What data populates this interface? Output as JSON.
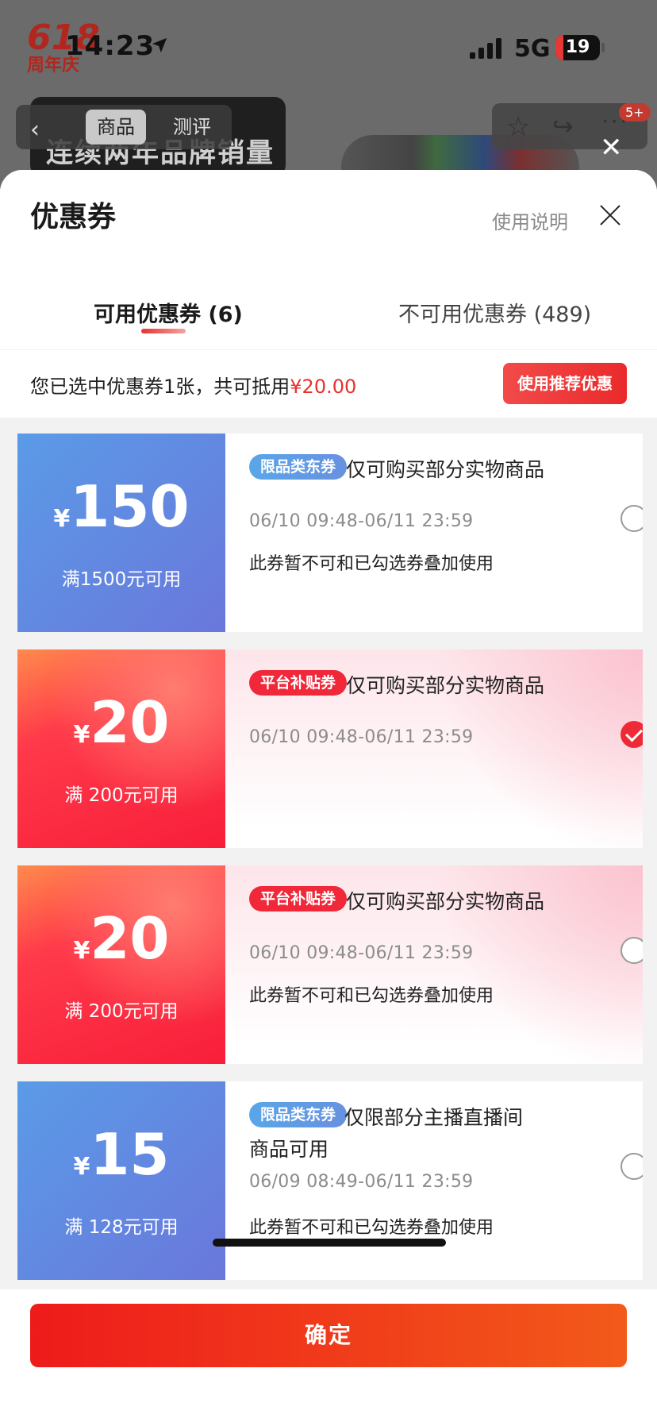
{
  "background": {
    "logo_number": "618",
    "logo_text": "周年庆",
    "nav_tabs": [
      "商品",
      "测评"
    ],
    "banner_text": "连续两年品牌销量",
    "notification_count": "5+"
  },
  "status_bar": {
    "time": "14:23",
    "network": "5G",
    "battery": "19"
  },
  "sheet": {
    "title": "优惠券",
    "usage_link": "使用说明",
    "tabs": [
      {
        "label": "可用优惠券 (6)",
        "active": true
      },
      {
        "label": "不可用优惠券 (489)",
        "active": false
      }
    ],
    "summary": {
      "text": "您已选中优惠券1张，共可抵用",
      "amount": "¥20.00",
      "button": "使用推荐优惠"
    }
  },
  "coupons": [
    {
      "style": "blue",
      "currency": "¥",
      "amount": "150",
      "threshold": "满1500元可用",
      "tag": "限品类东券",
      "description": "仅可购买部分实物商品",
      "validity": "06/10 09:48-06/11 23:59",
      "note": "此券暂不可和已勾选券叠加使用",
      "selected": false
    },
    {
      "style": "red",
      "currency": "¥",
      "amount": "20",
      "threshold": "满 200元可用",
      "tag": "平台补贴券",
      "description": "仅可购买部分实物商品",
      "validity": "06/10 09:48-06/11 23:59",
      "note": "",
      "selected": true
    },
    {
      "style": "red",
      "currency": "¥",
      "amount": "20",
      "threshold": "满 200元可用",
      "tag": "平台补贴券",
      "description": "仅可购买部分实物商品",
      "validity": "06/10 09:48-06/11 23:59",
      "note": "此券暂不可和已勾选券叠加使用",
      "selected": false
    },
    {
      "style": "blue",
      "currency": "¥",
      "amount": "15",
      "threshold": "满 128元可用",
      "tag": "限品类东券",
      "description": "仅限部分主播直播间商品可用",
      "validity": "06/09 08:49-06/11 23:59",
      "note": "此券暂不可和已勾选券叠加使用",
      "selected": false
    }
  ],
  "footer": {
    "confirm": "确定"
  }
}
